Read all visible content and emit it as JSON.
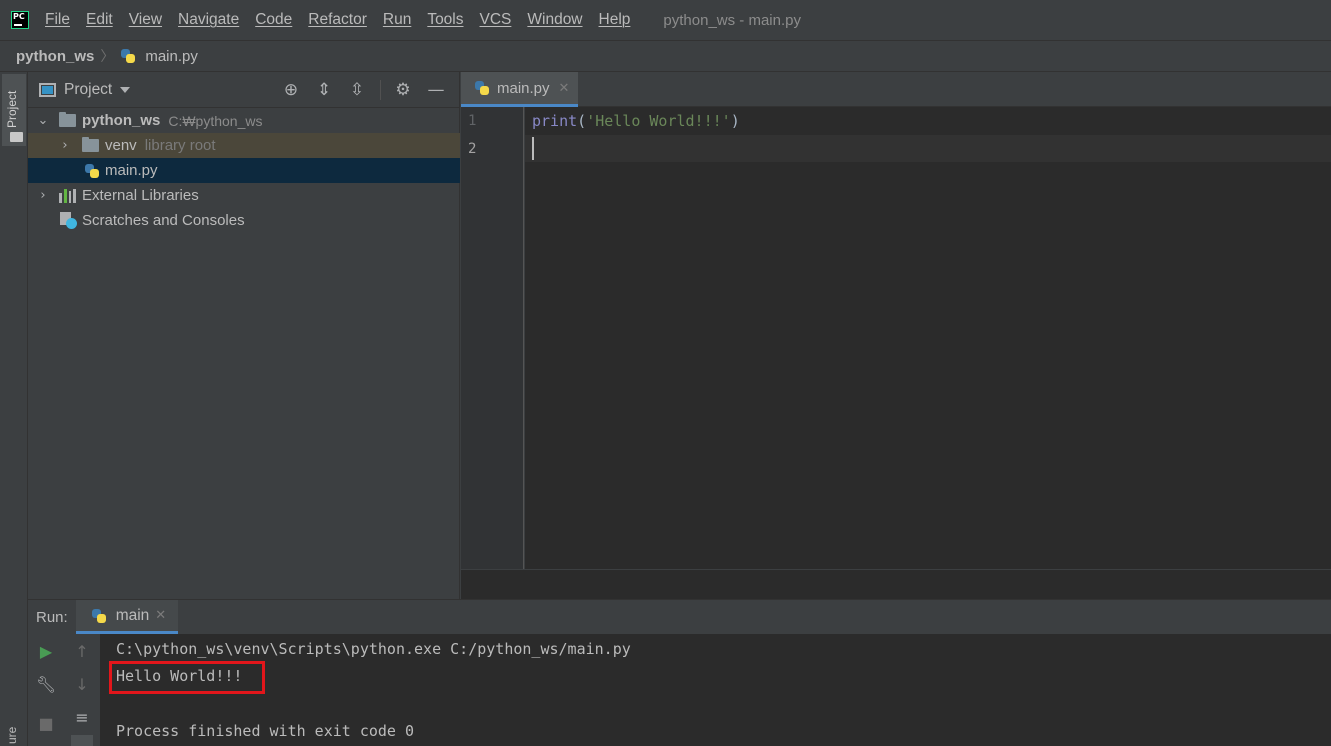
{
  "menubar": {
    "logo_text": "PC",
    "items": [
      "File",
      "Edit",
      "View",
      "Navigate",
      "Code",
      "Refactor",
      "Run",
      "Tools",
      "VCS",
      "Window",
      "Help"
    ],
    "window_title": "python_ws - main.py"
  },
  "navbar": {
    "project": "python_ws",
    "separator": "〉",
    "file": "main.py"
  },
  "left_stripe": {
    "project_label": "Project",
    "bottom_label": "ure"
  },
  "project_panel": {
    "title": "Project",
    "tree": {
      "root_name": "python_ws",
      "root_path": "C:₩python_ws",
      "venv_name": "venv",
      "venv_hint": "library root",
      "file_name": "main.py",
      "external_libraries": "External Libraries",
      "scratches": "Scratches and Consoles"
    }
  },
  "editor": {
    "tab_label": "main.py",
    "line_numbers": [
      "1",
      "2"
    ],
    "code": {
      "func": "print",
      "open_paren": "(",
      "string": "'Hello World!!!'",
      "close_paren": ")"
    }
  },
  "run_panel": {
    "label": "Run:",
    "tab_label": "main",
    "console": {
      "command": "C:\\python_ws\\venv\\Scripts\\python.exe C:/python_ws/main.py",
      "output": "Hello World!!!",
      "exit_message": "Process finished with exit code 0"
    }
  },
  "colors": {
    "background": "#3c3f41",
    "editor_bg": "#2b2b2b",
    "accent": "#4a88c7",
    "string": "#6a8759",
    "builtin": "#8888c6",
    "highlight_box": "#e2161b",
    "run_green": "#499c54"
  }
}
